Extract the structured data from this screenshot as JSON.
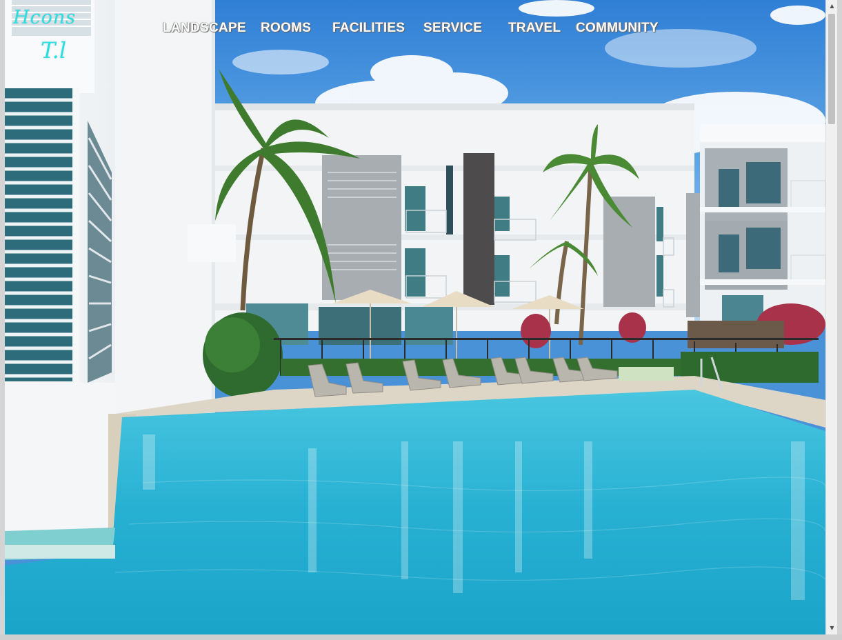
{
  "logo": {
    "line1": "Hcons",
    "line2": "T.l"
  },
  "nav": {
    "items": [
      {
        "label": "LANDSCAPE"
      },
      {
        "label": "ROOMS"
      },
      {
        "label": "FACILITIES"
      },
      {
        "label": "SERVICE"
      },
      {
        "label": "TRAVEL"
      },
      {
        "label": "COMMUNITY"
      }
    ]
  },
  "colors": {
    "logo": "#27e0e0",
    "nav_text": "#ffffff",
    "sky": "#3f88d6",
    "pool": "#2bb4d4"
  },
  "icons": {
    "scroll_up": "arrow-up-icon",
    "scroll_down": "arrow-down-icon"
  },
  "scrollbar": {
    "up_glyph": "▲",
    "down_glyph": "▼"
  }
}
